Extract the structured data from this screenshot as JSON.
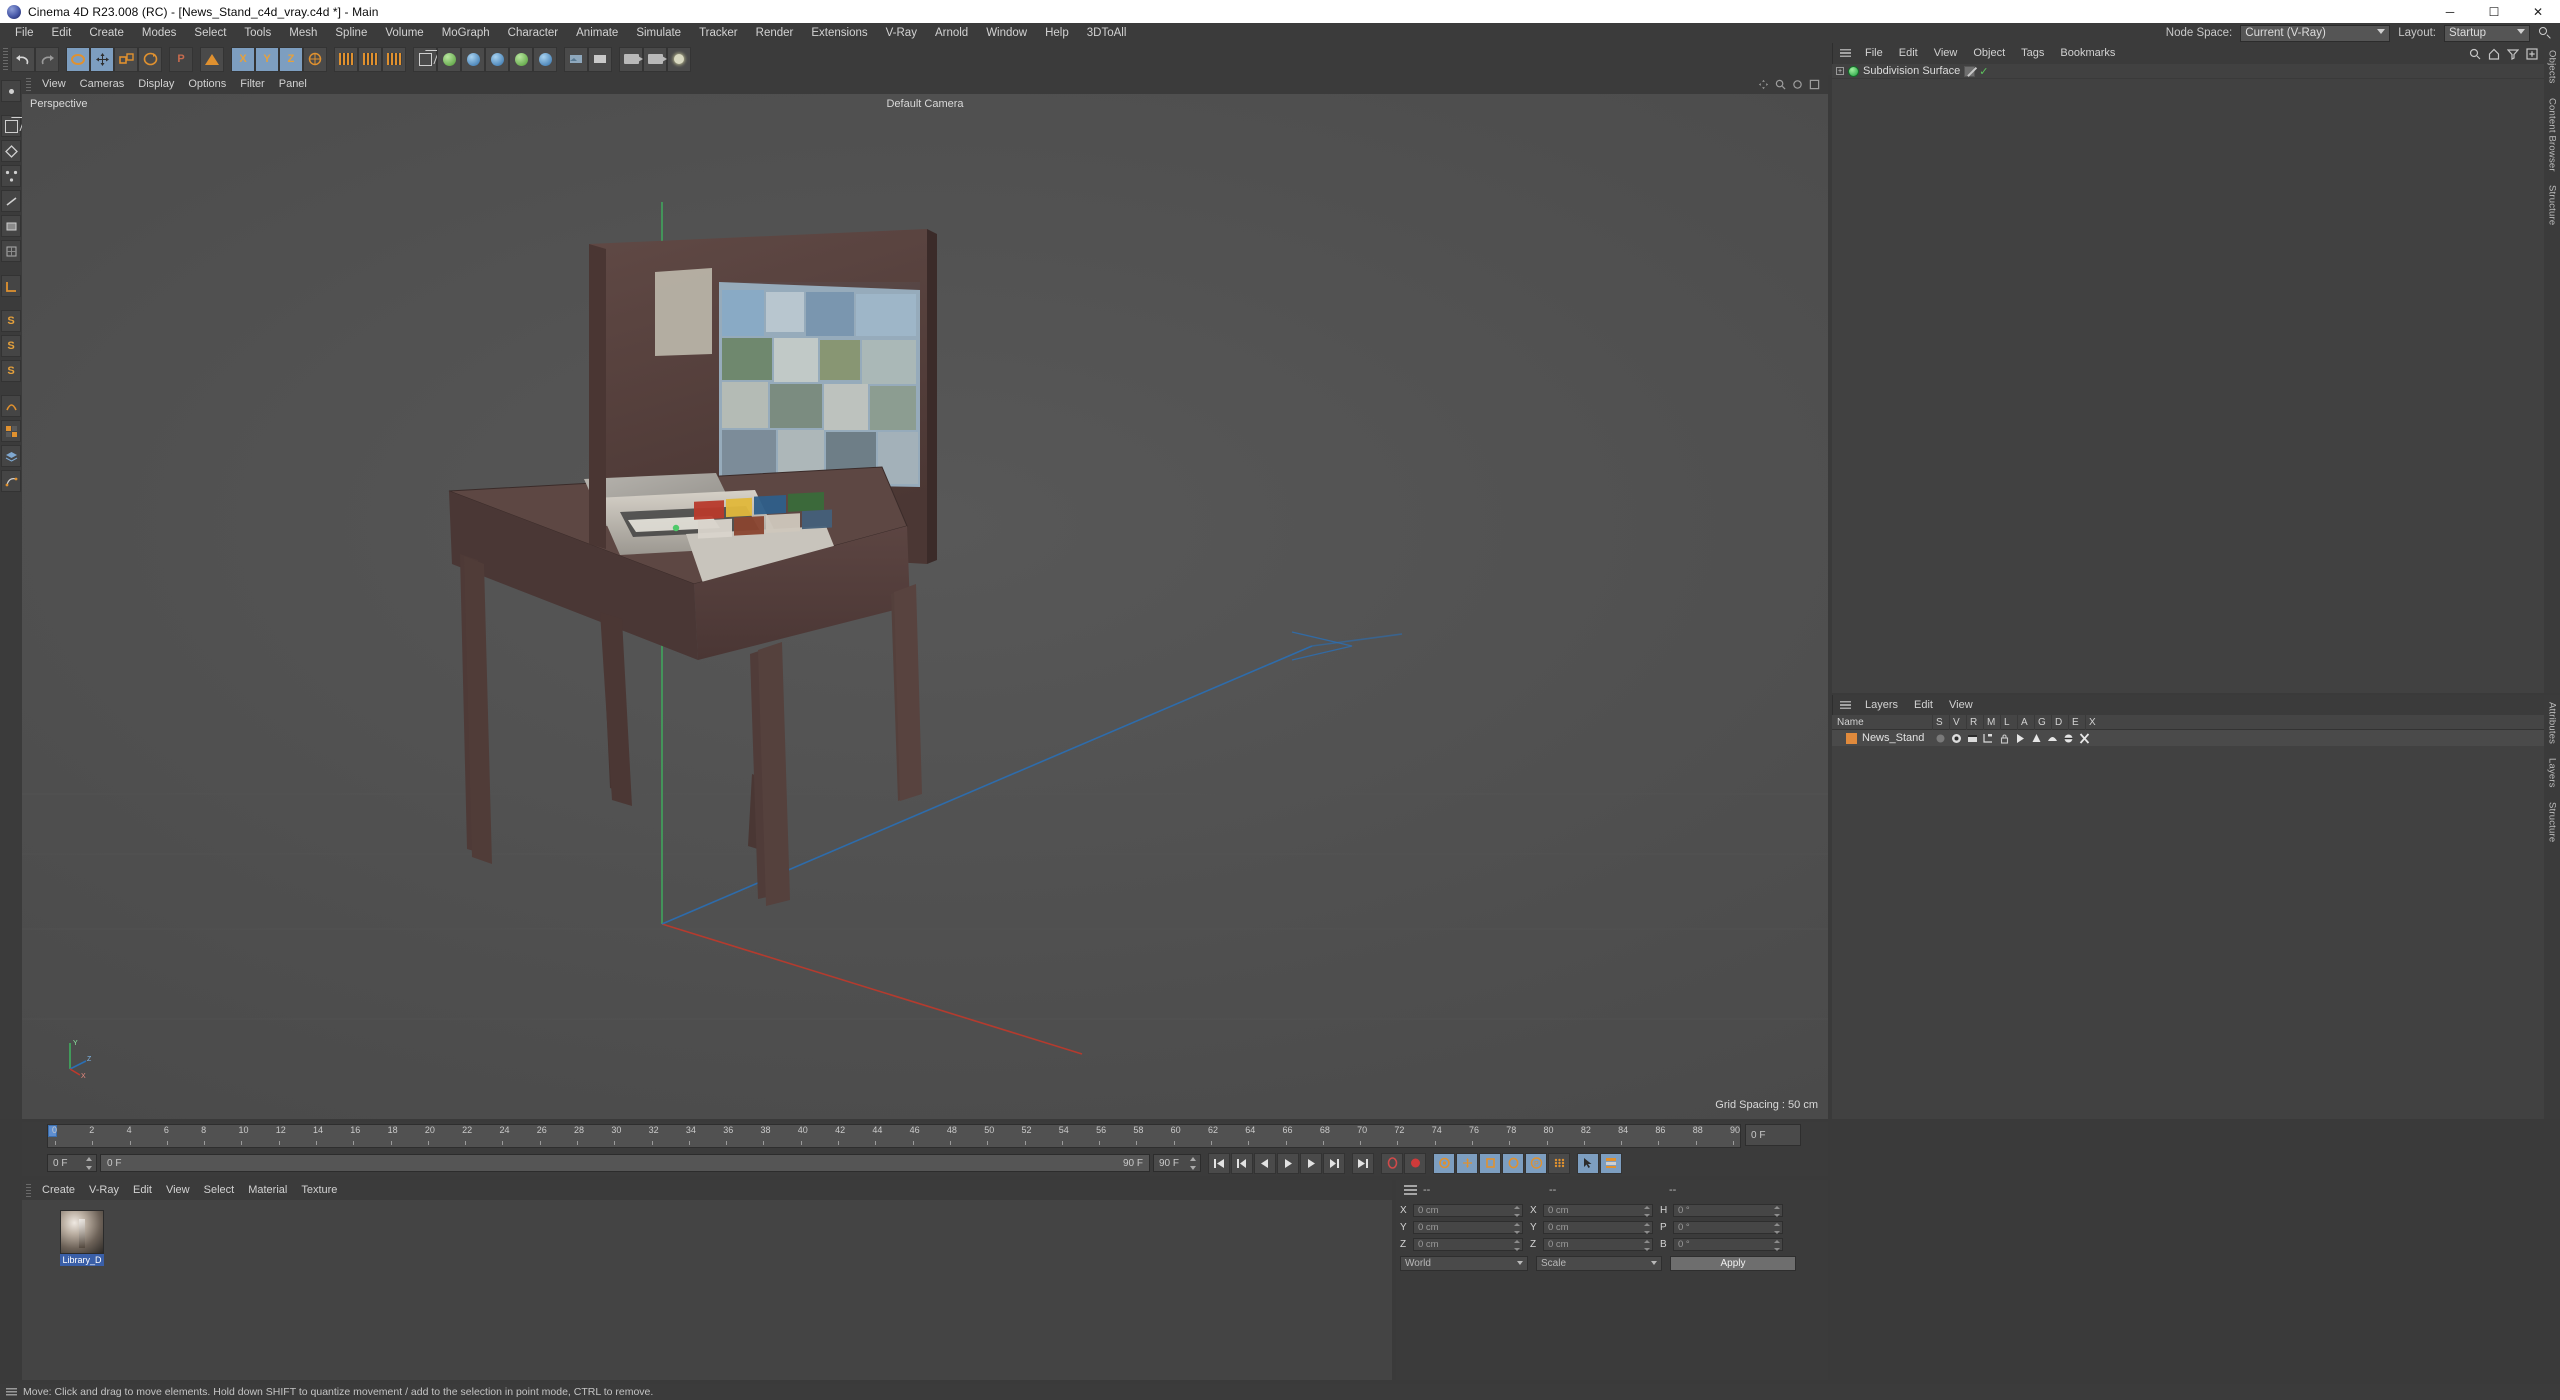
{
  "titlebar": {
    "title": "Cinema 4D R23.008 (RC) - [News_Stand_c4d_vray.c4d *] - Main",
    "minimize": "─",
    "maximize": "☐",
    "close": "✕"
  },
  "menubar": {
    "items": [
      "File",
      "Edit",
      "Create",
      "Modes",
      "Select",
      "Tools",
      "Mesh",
      "Spline",
      "Volume",
      "MoGraph",
      "Character",
      "Animate",
      "Simulate",
      "Tracker",
      "Render",
      "Extensions",
      "V-Ray",
      "Arnold",
      "Window",
      "Help",
      "3DToAll"
    ],
    "node_space_label": "Node Space:",
    "node_space_value": "Current (V-Ray)",
    "layout_label": "Layout:",
    "layout_value": "Startup",
    "search_icon": "search-icon"
  },
  "viewport": {
    "menu": [
      "View",
      "Cameras",
      "Display",
      "Options",
      "Filter",
      "Panel"
    ],
    "label_perspective": "Perspective",
    "label_camera": "Default Camera",
    "label_grid": "Grid Spacing : 50 cm",
    "axis_x": "X",
    "axis_y": "Y",
    "axis_z": "Z"
  },
  "timeline": {
    "ticks": [
      "0",
      "2",
      "4",
      "6",
      "8",
      "10",
      "12",
      "14",
      "16",
      "18",
      "20",
      "22",
      "24",
      "26",
      "28",
      "30",
      "32",
      "34",
      "36",
      "38",
      "40",
      "42",
      "44",
      "46",
      "48",
      "50",
      "52",
      "54",
      "56",
      "58",
      "60",
      "62",
      "64",
      "66",
      "68",
      "70",
      "72",
      "74",
      "76",
      "78",
      "80",
      "82",
      "84",
      "86",
      "88",
      "90"
    ],
    "end_field": "0 F"
  },
  "playback": {
    "current_frame": "0 F",
    "range_start": "0 F",
    "range_end": "90 F",
    "max_frame": "90 F",
    "buttons": [
      {
        "name": "go-to-start-button",
        "glyph": "goto-start"
      },
      {
        "name": "previous-key-button",
        "glyph": "prev-key"
      },
      {
        "name": "step-back-button",
        "glyph": "step-back"
      },
      {
        "name": "play-button",
        "glyph": "play"
      },
      {
        "name": "step-forward-button",
        "glyph": "step-forward"
      },
      {
        "name": "next-key-button",
        "glyph": "next-key"
      },
      {
        "name": "go-to-end-button",
        "glyph": "goto-end"
      }
    ]
  },
  "material_manager": {
    "menu": [
      "Create",
      "V-Ray",
      "Edit",
      "View",
      "Select",
      "Material",
      "Texture"
    ],
    "materials": [
      {
        "name": "Library_D",
        "selected": true
      }
    ]
  },
  "coordinates": {
    "header": [
      "--",
      "--",
      "--"
    ],
    "rows": [
      {
        "pos_label": "X",
        "pos_value": "0 cm",
        "size_label": "X",
        "size_value": "0 cm",
        "rot_label": "H",
        "rot_value": "0 °"
      },
      {
        "pos_label": "Y",
        "pos_value": "0 cm",
        "size_label": "Y",
        "size_value": "0 cm",
        "rot_label": "P",
        "rot_value": "0 °"
      },
      {
        "pos_label": "Z",
        "pos_value": "0 cm",
        "size_label": "Z",
        "size_value": "0 cm",
        "rot_label": "B",
        "rot_value": "0 °"
      }
    ],
    "system": "World",
    "mode": "Scale",
    "apply": "Apply"
  },
  "object_manager": {
    "menu": [
      "File",
      "Edit",
      "View",
      "Object",
      "Tags",
      "Bookmarks"
    ],
    "objects": [
      {
        "name": "Subdivision Surface",
        "expandable": true,
        "visible_check": "✓"
      }
    ],
    "icons": [
      "search-icon",
      "home-icon",
      "filter-icon",
      "add-icon"
    ]
  },
  "layers": {
    "menu": [
      "Layers",
      "Edit",
      "View"
    ],
    "columns": [
      "Name",
      "S",
      "V",
      "R",
      "M",
      "L",
      "A",
      "G",
      "D",
      "E",
      "X"
    ],
    "rows": [
      {
        "name": "News_Stand",
        "color": "#e08a3c"
      }
    ]
  },
  "right_tabs_top": [
    "Objects",
    "Content Browser",
    "Structure"
  ],
  "right_tabs_bottom": [
    "Attributes",
    "Layers",
    "Structure"
  ],
  "statusbar": {
    "text": "Move: Click and drag to move elements. Hold down SHIFT to quantize movement / add to the selection in point mode, CTRL to remove."
  },
  "colors": {
    "accent_blue": "#7d9ec0",
    "orange": "#e0912f",
    "layer_orange": "#e08a3c",
    "panel_bg": "#3b3b3b",
    "viewport_bg": "#4e4e4e",
    "axis_x": "#c0392b",
    "axis_y": "#27ae60",
    "axis_z": "#2a6fb5"
  }
}
